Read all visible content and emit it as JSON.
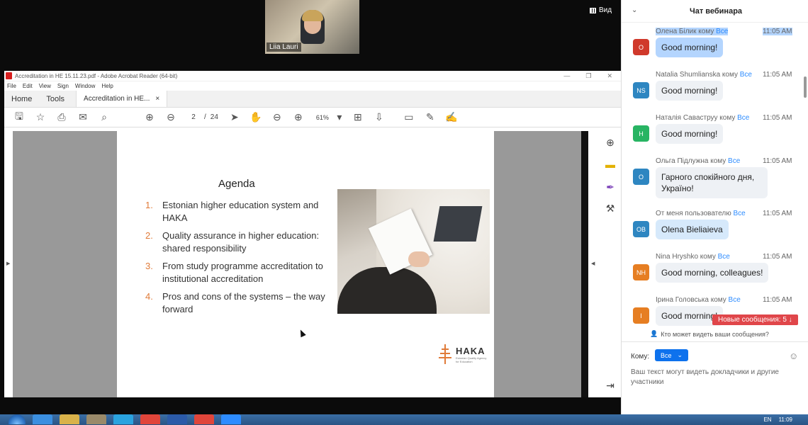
{
  "zoom": {
    "participant_name": "Liia Lauri",
    "view_label": "Вид"
  },
  "acrobat": {
    "window_title": "Accreditation in HE 15.11.23.pdf - Adobe Acrobat Reader (64-bit)",
    "menu": [
      "File",
      "Edit",
      "View",
      "Sign",
      "Window",
      "Help"
    ],
    "tabs": {
      "home": "Home",
      "tools": "Tools",
      "doc_tab": "Accreditation in HE...",
      "doc_tab_close": "×"
    },
    "page_current": "2",
    "page_sep": "/",
    "page_total": "24",
    "zoom": "61%",
    "icons": [
      "save-icon",
      "star-icon",
      "print-icon",
      "mail-icon",
      "search-icon",
      "page-up-icon",
      "page-down-icon",
      "select-cursor-icon",
      "hand-icon",
      "zoom-out-icon",
      "zoom-in-icon",
      "fit-page-icon",
      "scroll-mode-icon",
      "comment-icon",
      "pen-icon",
      "sign-icon"
    ]
  },
  "slide": {
    "title": "Agenda",
    "items": [
      {
        "num": "1.",
        "text": "Estonian higher education system and HAKA"
      },
      {
        "num": "2.",
        "text": "Quality assurance in  higher education: shared responsibility"
      },
      {
        "num": "3.",
        "text": "From study programme accreditation to institutional accreditation"
      },
      {
        "num": "4.",
        "text": "Pros and cons of the systems – the way forward"
      }
    ],
    "logo_brand": "HAKA",
    "logo_sub": "Estonian Quality Agency for Education",
    "accent_color": "#e07b39"
  },
  "chat": {
    "title": "Чат вебинара",
    "messages": [
      {
        "sender": "Олена Білик кому",
        "to": "Все",
        "time": "11:05 AM",
        "avatar": "О",
        "avatar_color": "#d0392b",
        "text": "Good morning!"
      },
      {
        "sender": "Natalia Shumlianska кому",
        "to": "Все",
        "time": "11:05 AM",
        "avatar": "NS",
        "avatar_color": "#2e86c1",
        "text": "Good morning!"
      },
      {
        "sender": "Наталія Саваструу кому",
        "to": "Все",
        "time": "11:05 AM",
        "avatar": "Н",
        "avatar_color": "#28b463",
        "text": "Good morning!"
      },
      {
        "sender": "Ольга Підлужна кому",
        "to": "Все",
        "time": "11:05 AM",
        "avatar": "О",
        "avatar_color": "#2e86c1",
        "text": "Гарного спокійного дня, Україно!"
      },
      {
        "sender": "От меня пользователю",
        "to": "Все",
        "time": "11:05 AM",
        "avatar": "OB",
        "avatar_color": "#2e86c1",
        "text": "Olena Bieliaieva"
      },
      {
        "sender": "Nina Hryshko кому",
        "to": "Все",
        "time": "11:05 AM",
        "avatar": "NH",
        "avatar_color": "#e67e22",
        "text": "Good morning, colleagues!"
      },
      {
        "sender": "Ірина Головська кому",
        "to": "Все",
        "time": "11:05 AM",
        "avatar": "І",
        "avatar_color": "#e67e22",
        "text": "Good morning!"
      }
    ],
    "new_messages": "Новые сообщения: 5 ↓",
    "who_can_see": "Кто может видеть ваши сообщения?",
    "to_label": "Кому:",
    "to_value": "Все",
    "hint": "Ваш текст могут видеть докладчики и другие участники"
  },
  "taskbar": {
    "lang": "EN",
    "clock": "11:09"
  }
}
